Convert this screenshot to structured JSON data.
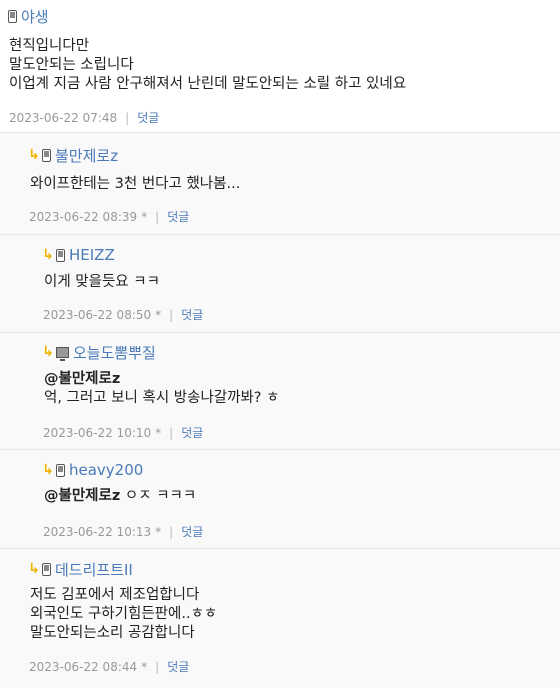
{
  "comments": [
    {
      "nick": "야생",
      "device": "phone-icon",
      "lines": [
        "현직입니다만",
        "말도안되는 소립니다",
        "이업계 지금 사람 안구해져서 난린데 말도안되는 소릴 하고 있네요"
      ],
      "time": "2023-06-22 07:48",
      "reply": "덧글"
    },
    {
      "nick": "불만제로z",
      "device": "phone-icon",
      "lines": [
        "와이프한테는 3천 번다고 했나봄..."
      ],
      "time": "2023-06-22 08:39",
      "star": "*",
      "reply": "덧글"
    },
    {
      "nick": "HEIZZ",
      "device": "phone-icon",
      "lines": [
        "이게 맞을듯요 ㅋㅋ"
      ],
      "time": "2023-06-22 08:50",
      "star": "*",
      "reply": "덧글"
    },
    {
      "nick": "오늘도뽐뿌질",
      "device": "pc-icon",
      "mention": "@불만제로z",
      "lines": [
        "억, 그러고 보니 혹시 방송나갈까봐? ㅎ"
      ],
      "time": "2023-06-22 10:10",
      "star": "*",
      "reply": "덧글"
    },
    {
      "nick": "heavy200",
      "device": "phone-icon",
      "mention": "@불만제로z",
      "after_mention": " ㅇㅈ ㅋㅋㅋ",
      "time": "2023-06-22 10:13",
      "star": "*",
      "reply": "덧글"
    },
    {
      "nick": "데드리프트II",
      "device": "phone-icon",
      "lines": [
        "저도 김포에서 제조업합니다",
        "외국인도 구하기힘든판에..ㅎㅎ",
        "말도안되는소리 공감합니다"
      ],
      "time": "2023-06-22 08:44",
      "star": "*",
      "reply": "덧글"
    }
  ],
  "meta_separator": "|",
  "reply_arrow": "↳"
}
